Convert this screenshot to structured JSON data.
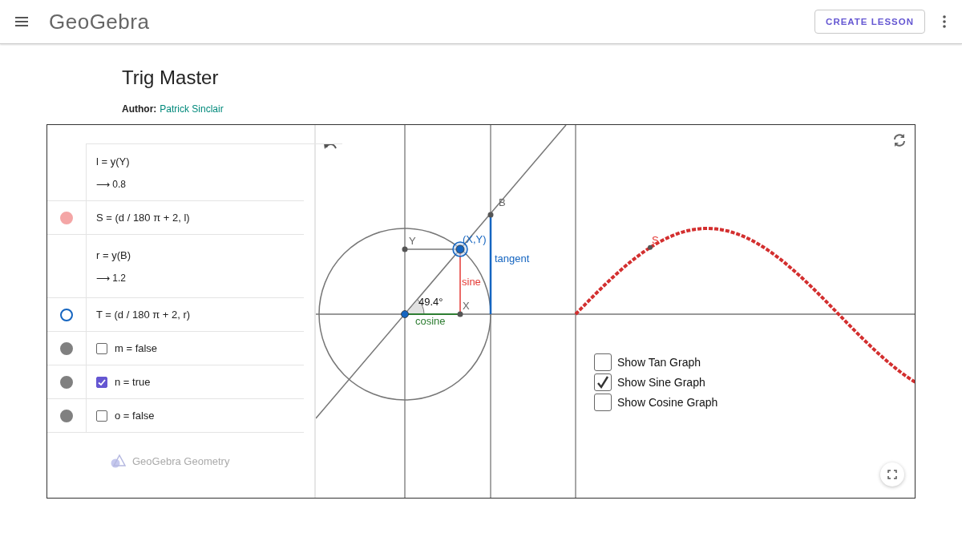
{
  "header": {
    "logo": "GeoGebra",
    "button": "CREATE LESSON"
  },
  "title": "Trig Master",
  "author": {
    "label": "Author:",
    "name": "Patrick Sinclair"
  },
  "algebra": [
    {
      "kind": "value",
      "text": "l = y(Y)",
      "output": "⟶ 0.8"
    },
    {
      "kind": "expression",
      "text": "S = (d / 180 π + 2, l)",
      "color": "#f4a6a6",
      "filled": true
    },
    {
      "kind": "value",
      "text": "r = y(B)",
      "output": "⟶ 1.2"
    },
    {
      "kind": "expression",
      "text": "T = (d / 180 π + 2, r)",
      "color": "#1565c0",
      "filled": false
    },
    {
      "kind": "checkbox",
      "text": "m = false",
      "checked": false,
      "color": "#808080",
      "filled": true
    },
    {
      "kind": "checkbox",
      "text": "n = true",
      "checked": true,
      "color": "#808080",
      "filled": true
    },
    {
      "kind": "checkbox",
      "text": "o = false",
      "checked": false,
      "color": "#808080",
      "filled": true
    }
  ],
  "algebra_footer": "GeoGebra Geometry",
  "labels": {
    "y_point": "Y",
    "xy_point": "(X,Y)",
    "b_point": "B",
    "x_point": "X",
    "s_point": "S",
    "sine": "sine",
    "tangent": "tangent",
    "cosine": "cosine",
    "angle": "49.4°"
  },
  "graph_options": [
    {
      "label": "Show Tan Graph",
      "checked": false
    },
    {
      "label": "Show Sine Graph",
      "checked": true
    },
    {
      "label": "Show Cosine Graph",
      "checked": false
    }
  ]
}
